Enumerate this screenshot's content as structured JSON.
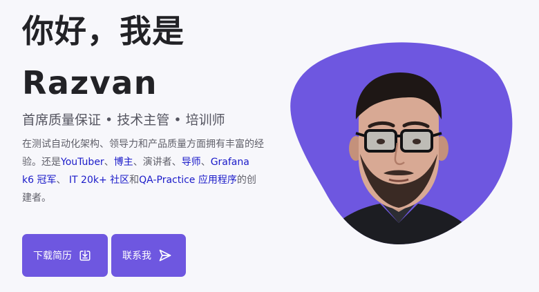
{
  "hero": {
    "title_line1": "你好，我是",
    "title_line2": "Razvan",
    "subtitle": "首席质量保证 • 技术主管 • 培训师",
    "bio": {
      "part1": "在测试自动化架构、领导力和产品质量方面拥有丰富的经验。还是",
      "youtuber": "YouTuber",
      "sep1": "、",
      "blogger": "博主",
      "part2": "、演讲者、",
      "mentor": "导师",
      "sep2": "、",
      "grafana": "Grafana k6 冠军",
      "sep3": "、 ",
      "it": "IT 20k+ 社区",
      "and": "和",
      "qa": "QA-Practice 应用程序",
      "part3": "的创建者。"
    },
    "buttons": {
      "cv_label": "下载简历",
      "contact_label": "联系我"
    },
    "icons": {
      "cv": "download-icon",
      "contact": "send-icon"
    },
    "colors": {
      "accent": "#6e57e0",
      "link": "#1a1ac9",
      "title": "#222226",
      "text": "#60606a",
      "background": "#f7f7fb"
    }
  }
}
